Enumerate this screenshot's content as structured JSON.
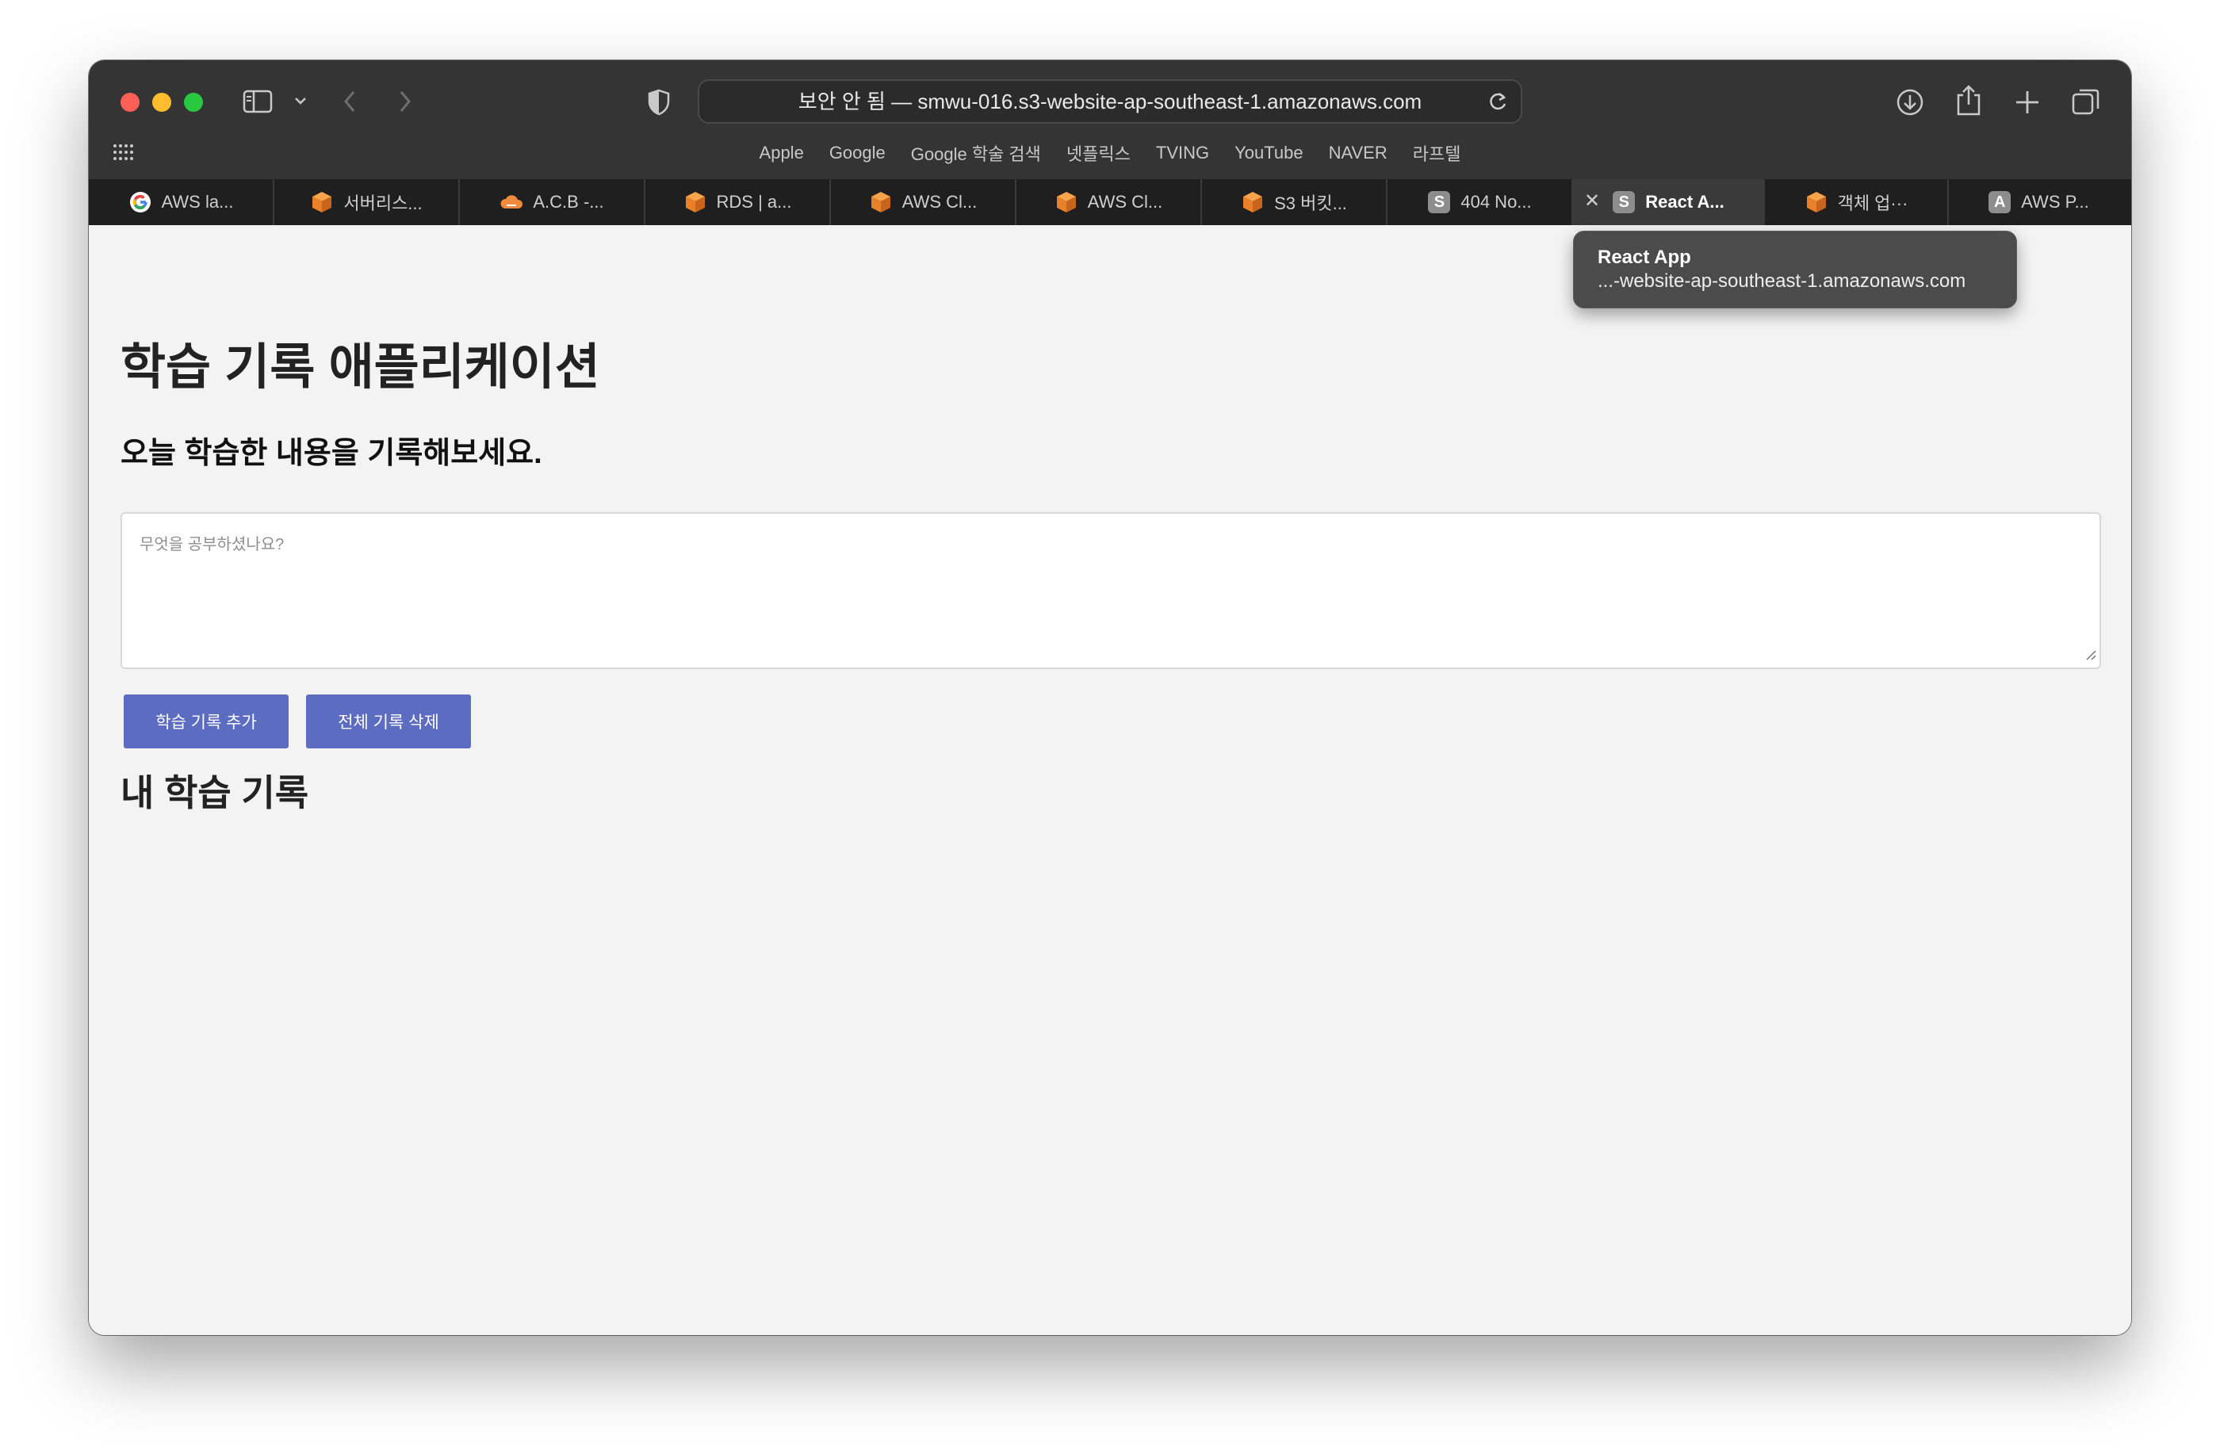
{
  "browser": {
    "address": "보안 안 됨 — smwu-016.s3-website-ap-southeast-1.amazonaws.com",
    "bookmarks": [
      "Apple",
      "Google",
      "Google 학술 검색",
      "넷플릭스",
      "TVING",
      "YouTube",
      "NAVER",
      "라프텔"
    ]
  },
  "tabs": [
    {
      "label": "AWS la...",
      "icon": "google-icon"
    },
    {
      "label": "서버리스...",
      "icon": "aws-cube-icon"
    },
    {
      "label": "A.C.B -...",
      "icon": "cloud-icon"
    },
    {
      "label": "RDS | a...",
      "icon": "aws-cube-icon"
    },
    {
      "label": "AWS Cl...",
      "icon": "aws-cube-icon"
    },
    {
      "label": "AWS Cl...",
      "icon": "aws-cube-icon"
    },
    {
      "label": "S3 버킷...",
      "icon": "aws-cube-icon"
    },
    {
      "label": "404 No...",
      "icon": "letter-s-icon",
      "letter": "S"
    },
    {
      "label": "React A...",
      "icon": "letter-s-icon",
      "letter": "S",
      "active": true
    },
    {
      "label": "객체 업···",
      "icon": "aws-cube-icon"
    },
    {
      "label": "AWS P...",
      "icon": "letter-a-icon",
      "letter": "A"
    }
  ],
  "tooltip": {
    "title": "React App",
    "url": "...-website-ap-southeast-1.amazonaws.com"
  },
  "page": {
    "title": "학습 기록 애플리케이션",
    "subtitle": "오늘 학습한 내용을 기록해보세요.",
    "input_placeholder": "무엇을 공부하셨나요?",
    "add_button": "학습 기록 추가",
    "delete_button": "전체 기록 삭제",
    "records_heading": "내 학습 기록"
  },
  "colors": {
    "button": "#5b6cc1",
    "toolbar": "#343434",
    "tabbar": "#1f1f1f",
    "page_bg": "#f3f3f3"
  }
}
